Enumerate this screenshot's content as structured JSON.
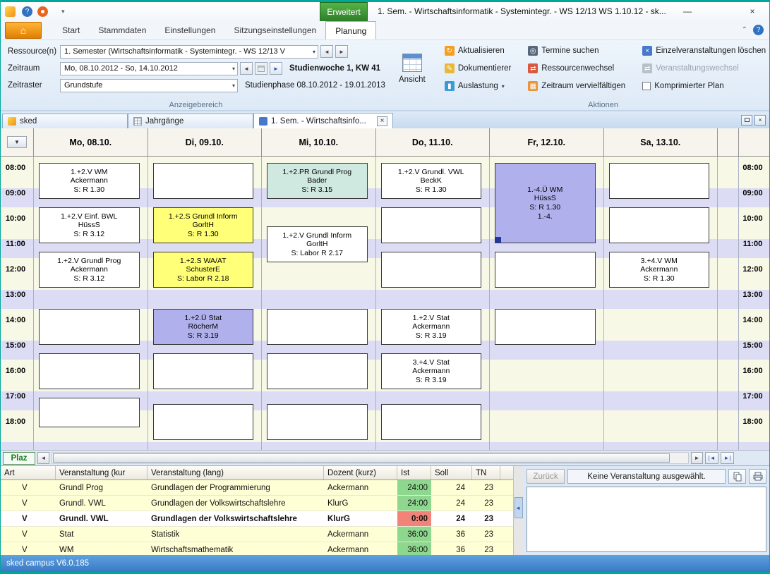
{
  "titlebar": {
    "contextual_tab_group": "Erweitert",
    "title": "1. Sem. - Wirtschaftsinformatik - Systemintegr. - WS 12/13 WS 1.10.12 - sk..."
  },
  "ribbon": {
    "tabs": [
      {
        "label": "Start",
        "active": false
      },
      {
        "label": "Stammdaten",
        "active": false
      },
      {
        "label": "Einstellungen",
        "active": false
      },
      {
        "label": "Sitzungseinstellungen",
        "active": false
      },
      {
        "label": "Planung",
        "active": true
      }
    ],
    "anzeigebereich": {
      "caption": "Anzeigebereich",
      "rows": [
        {
          "label": "Ressource(n)",
          "value": "1. Semester (Wirtschaftsinformatik - Systemintegr. - WS 12/13 V"
        },
        {
          "label": "Zeitraum",
          "value": "Mo, 08.10.2012 - So, 14.10.2012",
          "info": "Studienwoche 1, KW 41"
        },
        {
          "label": "Zeitraster",
          "value": "Grundstufe",
          "info": "Studienphase 08.10.2012 - 19.01.2013"
        }
      ]
    },
    "ansicht": {
      "label": "Ansicht"
    },
    "aktionen": {
      "caption": "Aktionen",
      "columns": [
        [
          {
            "label": "Aktualisieren",
            "icon": "refresh-icon"
          },
          {
            "label": "Dokumentierer",
            "icon": "document-icon"
          },
          {
            "label": "Auslastung",
            "icon": "chart-icon",
            "dropdown": true
          }
        ],
        [
          {
            "label": "Termine suchen",
            "icon": "search-icon"
          },
          {
            "label": "Ressourcenwechsel",
            "icon": "swap-icon"
          },
          {
            "label": "Zeitraum vervielfältigen",
            "icon": "calendar-icon"
          }
        ],
        [
          {
            "label": "Einzelveranstaltungen löschen",
            "icon": "delete-icon"
          },
          {
            "label": "Veranstaltungswechsel",
            "icon": "change-icon",
            "disabled": true
          },
          {
            "label": "Komprimierter Plan",
            "checkbox": true
          }
        ]
      ]
    }
  },
  "doc_tabs": [
    {
      "label": "sked",
      "icon": "sked-icon",
      "active": false,
      "closable": false
    },
    {
      "label": "Jahrgänge",
      "icon": "table-icon",
      "active": false,
      "closable": false
    },
    {
      "label": "1. Sem. - Wirtschaftsinfo...",
      "icon": "plan-icon",
      "active": true,
      "closable": true
    }
  ],
  "calendar": {
    "days": [
      "Mo, 08.10.",
      "Di, 09.10.",
      "Mi, 10.10.",
      "Do, 11.10.",
      "Fr, 12.10.",
      "Sa, 13.10."
    ],
    "times": [
      "08:00",
      "09:00",
      "10:00",
      "11:00",
      "12:00",
      "13:00",
      "14:00",
      "15:00",
      "16:00",
      "17:00",
      "18:00"
    ],
    "events": [
      {
        "day": 0,
        "start": 8,
        "end": 9.5,
        "color": "white",
        "lines": [
          "1.+2.V WM",
          "Ackermann",
          "S: R 1.30"
        ]
      },
      {
        "day": 0,
        "start": 9.75,
        "end": 11.25,
        "color": "white",
        "lines": [
          "1.+2.V Einf. BWL",
          "HüssS",
          "S: R 3.12"
        ]
      },
      {
        "day": 0,
        "start": 11.5,
        "end": 13,
        "color": "white",
        "lines": [
          "1.+2.V Grundl Prog",
          "Ackermann",
          "S: R 3.12"
        ]
      },
      {
        "day": 0,
        "start": 13.75,
        "end": 15.25,
        "color": "white",
        "lines": []
      },
      {
        "day": 0,
        "start": 15.5,
        "end": 17,
        "color": "white",
        "lines": []
      },
      {
        "day": 0,
        "start": 17.25,
        "end": 18.5,
        "color": "white",
        "lines": []
      },
      {
        "day": 1,
        "start": 8,
        "end": 9.5,
        "color": "white",
        "lines": []
      },
      {
        "day": 1,
        "start": 9.75,
        "end": 11.25,
        "color": "yellow",
        "lines": [
          "1.+2.S Grundl Inform",
          "GorltH",
          "S: R 1.30"
        ]
      },
      {
        "day": 1,
        "start": 11.5,
        "end": 13,
        "color": "yellow",
        "lines": [
          "1.+2.S WA/AT",
          "SchusterE",
          "S: Labor R 2.18"
        ]
      },
      {
        "day": 1,
        "start": 13.75,
        "end": 15.25,
        "color": "purple",
        "lines": [
          "1.+2.Ü Stat",
          "RöcherM",
          "S: R 3.19"
        ]
      },
      {
        "day": 1,
        "start": 15.5,
        "end": 17,
        "color": "white",
        "lines": []
      },
      {
        "day": 1,
        "start": 17.5,
        "end": 19,
        "color": "white",
        "lines": []
      },
      {
        "day": 2,
        "start": 8,
        "end": 9.5,
        "color": "teal",
        "lines": [
          "1.+2.PR Grundl Prog",
          "Bader",
          "S: R 3.15"
        ]
      },
      {
        "day": 2,
        "start": 10.5,
        "end": 12,
        "color": "white",
        "lines": [
          "1.+2.V Grundl Inform",
          "GorltH",
          "S: Labor R 2.17"
        ]
      },
      {
        "day": 2,
        "start": 13.75,
        "end": 15.25,
        "color": "white",
        "lines": []
      },
      {
        "day": 2,
        "start": 15.5,
        "end": 17,
        "color": "white",
        "lines": []
      },
      {
        "day": 2,
        "start": 17.5,
        "end": 19,
        "color": "white",
        "lines": []
      },
      {
        "day": 3,
        "start": 8,
        "end": 9.5,
        "color": "white",
        "lines": [
          "1.+2.V Grundl. VWL",
          "BeckK",
          "S: R 1.30"
        ]
      },
      {
        "day": 3,
        "start": 9.75,
        "end": 11.25,
        "color": "white",
        "lines": []
      },
      {
        "day": 3,
        "start": 11.5,
        "end": 13,
        "color": "white",
        "lines": []
      },
      {
        "day": 3,
        "start": 13.75,
        "end": 15.25,
        "color": "white",
        "lines": [
          "1.+2.V Stat",
          "Ackermann",
          "S: R 3.19"
        ]
      },
      {
        "day": 3,
        "start": 15.5,
        "end": 17,
        "color": "white",
        "lines": [
          "3.+4.V Stat",
          "Ackermann",
          "S: R 3.19"
        ]
      },
      {
        "day": 3,
        "start": 17.5,
        "end": 19,
        "color": "white",
        "lines": []
      },
      {
        "day": 4,
        "start": 8,
        "end": 11.25,
        "color": "purple",
        "marker": true,
        "lines": [
          "1.-4.Ü WM",
          "HüssS",
          "S: R 1.30",
          "1.-4."
        ]
      },
      {
        "day": 4,
        "start": 11.5,
        "end": 13,
        "color": "white",
        "lines": []
      },
      {
        "day": 4,
        "start": 13.75,
        "end": 15.25,
        "color": "white",
        "lines": []
      },
      {
        "day": 5,
        "start": 8,
        "end": 9.5,
        "color": "white",
        "lines": []
      },
      {
        "day": 5,
        "start": 9.75,
        "end": 11.25,
        "color": "white",
        "lines": []
      },
      {
        "day": 5,
        "start": 11.5,
        "end": 13,
        "color": "white",
        "lines": [
          "3.+4.V WM",
          "Ackermann",
          "S: R 1.30"
        ]
      }
    ]
  },
  "scroll_row": {
    "plaz": "Plaz"
  },
  "table": {
    "columns": [
      "Art",
      "Veranstaltung (kur",
      "Veranstaltung (lang)",
      "Dozent (kurz)",
      "Ist",
      "Soll",
      "TN"
    ],
    "rows": [
      {
        "art": "V",
        "kurz": "Grundl Prog",
        "lang": "Grundlagen der Programmierung",
        "dozent": "Ackermann",
        "ist": "24:00",
        "ist_state": "ok",
        "soll": "24",
        "tn": "23",
        "selected": false
      },
      {
        "art": "V",
        "kurz": "Grundl. VWL",
        "lang": "Grundlagen der Volkswirtschaftslehre",
        "dozent": "KlurG",
        "ist": "24:00",
        "ist_state": "ok",
        "soll": "24",
        "tn": "23",
        "selected": false
      },
      {
        "art": "V",
        "kurz": "Grundl. VWL",
        "lang": "Grundlagen der Volkswirtschaftslehre",
        "dozent": "KlurG",
        "ist": "0:00",
        "ist_state": "zero",
        "soll": "24",
        "tn": "23",
        "selected": true
      },
      {
        "art": "V",
        "kurz": "Stat",
        "lang": "Statistik",
        "dozent": "Ackermann",
        "ist": "36:00",
        "ist_state": "ok",
        "soll": "36",
        "tn": "23",
        "selected": false
      },
      {
        "art": "V",
        "kurz": "WM",
        "lang": "Wirtschaftsmathematik",
        "dozent": "Ackermann",
        "ist": "36:00",
        "ist_state": "ok",
        "soll": "36",
        "tn": "23",
        "selected": false
      }
    ]
  },
  "details": {
    "back": "Zurück",
    "message": "Keine Veranstaltung ausgewählt."
  },
  "statusbar": {
    "text": "sked campus V6.0.185"
  }
}
